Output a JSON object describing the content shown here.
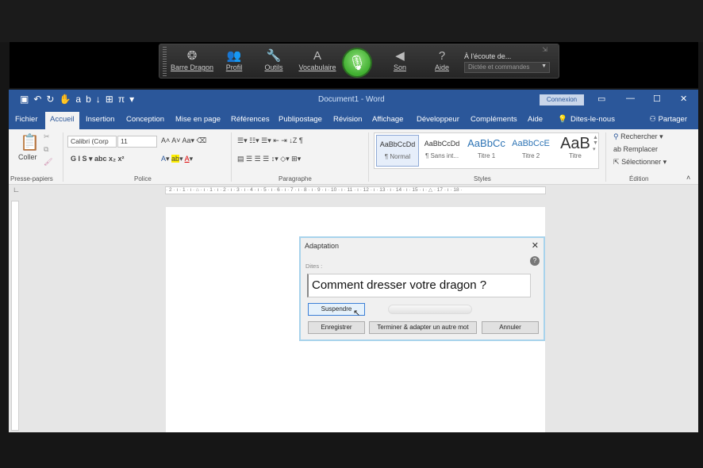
{
  "dragon_bar": {
    "buttons": [
      {
        "label": "Barre Dragon",
        "icon": "dragon-flame-icon",
        "glyph": "❂"
      },
      {
        "label": "Profil",
        "icon": "profile-users-icon",
        "glyph": "👥"
      },
      {
        "label": "Outils",
        "icon": "wrench-icon",
        "glyph": "🔧"
      },
      {
        "label": "Vocabulaire",
        "icon": "vocabulary-icon",
        "glyph": "A"
      },
      {
        "label": "Son",
        "icon": "speaker-icon",
        "glyph": "◀"
      },
      {
        "label": "Aide",
        "icon": "help-question-icon",
        "glyph": "?"
      }
    ],
    "listening": "À l'écoute de...",
    "mode": "Dictée et commandes",
    "mic_color": "#4fbf3a"
  },
  "word": {
    "title": "Document1 - Word",
    "connexion": "Connexion",
    "tabs": [
      "Fichier",
      "Accueil",
      "Insertion",
      "Conception",
      "Mise en page",
      "Références",
      "Publipostage",
      "Révision",
      "Affichage",
      "Développeur",
      "Compléments",
      "Aide",
      "Dites-le-nous"
    ],
    "active_tab": "Accueil",
    "partager": "Partager",
    "ribbon": {
      "coller": "Coller",
      "presse_papiers": "Presse-papiers",
      "font_name": "Calibri (Corp",
      "font_size": "11",
      "police": "Police",
      "paragraphe": "Paragraphe",
      "styles_label": "Styles",
      "styles": [
        {
          "preview": "AaBbCcDd",
          "name": "¶ Normal"
        },
        {
          "preview": "AaBbCcDd",
          "name": "¶ Sans int..."
        },
        {
          "preview": "AaBbCc",
          "name": "Titre 1"
        },
        {
          "preview": "AaBbCcE",
          "name": "Titre 2"
        },
        {
          "preview": "AaB",
          "name": "Titre"
        }
      ],
      "rechercher": "Rechercher",
      "remplacer": "Remplacer",
      "selectionner": "Sélectionner",
      "edition": "Édition"
    },
    "ruler": "· 2 · ı · 1 · ı · ⌂ · ı · 1 · ı · 2 · ı · 3 · ı · 4 · ı · 5 · ı · 6 · ı · 7 · ı · 8 · ı · 9 · ı · 10 · ı · 11 · ı · 12 · ı · 13 · ı · 14 · ı · 15 · ı · △ · 17 · ı · 18 ·",
    "accent": "#2b579a"
  },
  "dialog": {
    "title": "Adaptation",
    "dites": "Dites :",
    "phrase": "Comment dresser votre dragon ?",
    "suspendre": "Suspendre",
    "enregistrer": "Enregistrer",
    "terminer": "Terminer & adapter un autre mot",
    "annuler": "Annuler"
  }
}
